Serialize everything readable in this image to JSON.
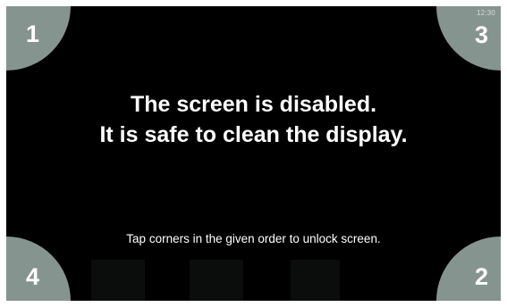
{
  "status_bar": {
    "time": "12:30"
  },
  "message": {
    "line1": "The screen is disabled.",
    "line2": "It is safe to clean the display."
  },
  "hint": "Tap corners in the given order to unlock screen.",
  "corners": {
    "top_left": "1",
    "bottom_right": "2",
    "top_right": "3",
    "bottom_left": "4"
  },
  "colors": {
    "screen_background": "#000000",
    "corner_fill": "#86948f",
    "text": "#ffffff"
  }
}
